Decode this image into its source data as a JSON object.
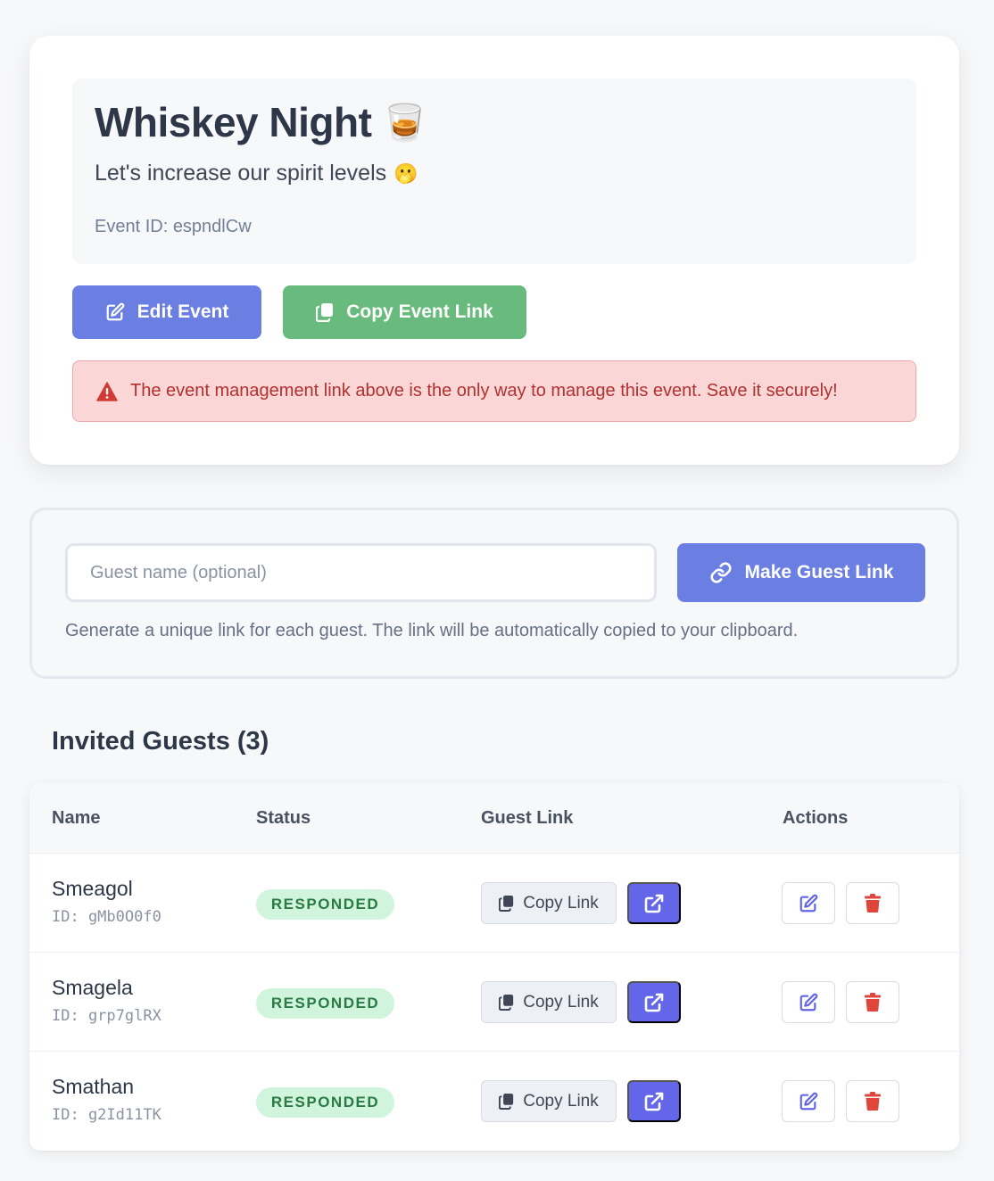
{
  "event": {
    "title": "Whiskey Night",
    "title_emoji": "🥃",
    "subtitle": "Let's increase our spirit levels",
    "subtitle_emoji": "🫢",
    "event_id_label": "Event ID: espndlCw"
  },
  "actions": {
    "edit_label": "Edit Event",
    "copy_label": "Copy Event Link"
  },
  "warning": {
    "icon": "warning-icon",
    "text": "The event management link above is the only way to manage this event. Save it securely!"
  },
  "guest_form": {
    "placeholder": "Guest name (optional)",
    "value": "",
    "button_label": "Make Guest Link",
    "help": "Generate a unique link for each guest. The link will be automatically copied to your clipboard."
  },
  "guests_section": {
    "title": "Invited Guests (3)"
  },
  "table": {
    "columns": [
      "Name",
      "Status",
      "Guest Link",
      "Actions"
    ],
    "copy_label": "Copy Link",
    "rows": [
      {
        "name": "Smeagol",
        "id": "ID: gMb0O0f0",
        "status": "RESPONDED"
      },
      {
        "name": "Smagela",
        "id": "ID: grp7glRX",
        "status": "RESPONDED"
      },
      {
        "name": "Smathan",
        "id": "ID: g2Id11TK",
        "status": "RESPONDED"
      }
    ]
  },
  "colors": {
    "primary": "#6b7fe3",
    "success": "#68bb7c",
    "danger_bg": "#fad6d6",
    "danger_text": "#b1312f",
    "open_link": "#6366e8",
    "delete_icon": "#e0453c"
  }
}
